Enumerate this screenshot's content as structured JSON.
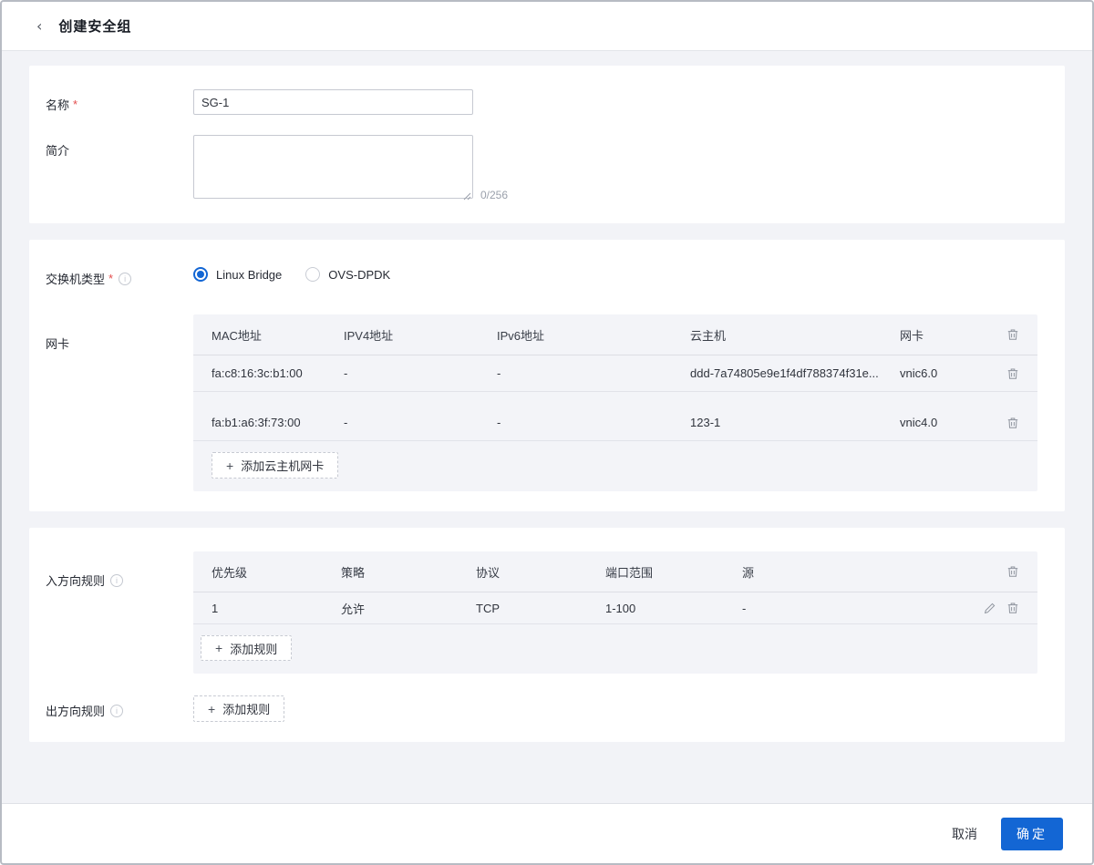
{
  "header": {
    "title": "创建安全组",
    "back_icon": "chevron-left"
  },
  "basic": {
    "name_label": "名称",
    "required_mark": "*",
    "name_value": "SG-1",
    "desc_label": "简介",
    "desc_value": "",
    "desc_counter": "0/256"
  },
  "network": {
    "switch_type_label": "交换机类型",
    "switch_options": [
      {
        "label": "Linux Bridge",
        "selected": true
      },
      {
        "label": "OVS-DPDK",
        "selected": false
      }
    ],
    "nic_label": "网卡",
    "nic_table": {
      "headers": [
        "MAC地址",
        "IPV4地址",
        "IPv6地址",
        "云主机",
        "网卡"
      ],
      "rows": [
        [
          "fa:c8:16:3c:b1:00",
          "-",
          "-",
          "ddd-7a74805e9e1f4df788374f31e...",
          "vnic6.0"
        ],
        [
          "fa:b1:a6:3f:73:00",
          "-",
          "-",
          "123-1",
          "vnic4.0"
        ]
      ],
      "add_plus": "+",
      "add_label": "添加云主机网卡"
    }
  },
  "rules": {
    "inbound_label": "入方向规则",
    "inbound_table": {
      "headers": [
        "优先级",
        "策略",
        "协议",
        "端口范围",
        "源"
      ],
      "rows": [
        [
          "1",
          "允许",
          "TCP",
          "1-100",
          "-"
        ]
      ],
      "add_plus": "+",
      "add_label": "添加规则"
    },
    "outbound_label": "出方向规则",
    "outbound_add_plus": "+",
    "outbound_add_label": "添加规则"
  },
  "footer": {
    "cancel_label": "取消",
    "confirm_label": "确定"
  },
  "colors": {
    "primary": "#1366d4",
    "panel_bg": "#f3f4f8",
    "page_bg": "#f2f3f7"
  }
}
